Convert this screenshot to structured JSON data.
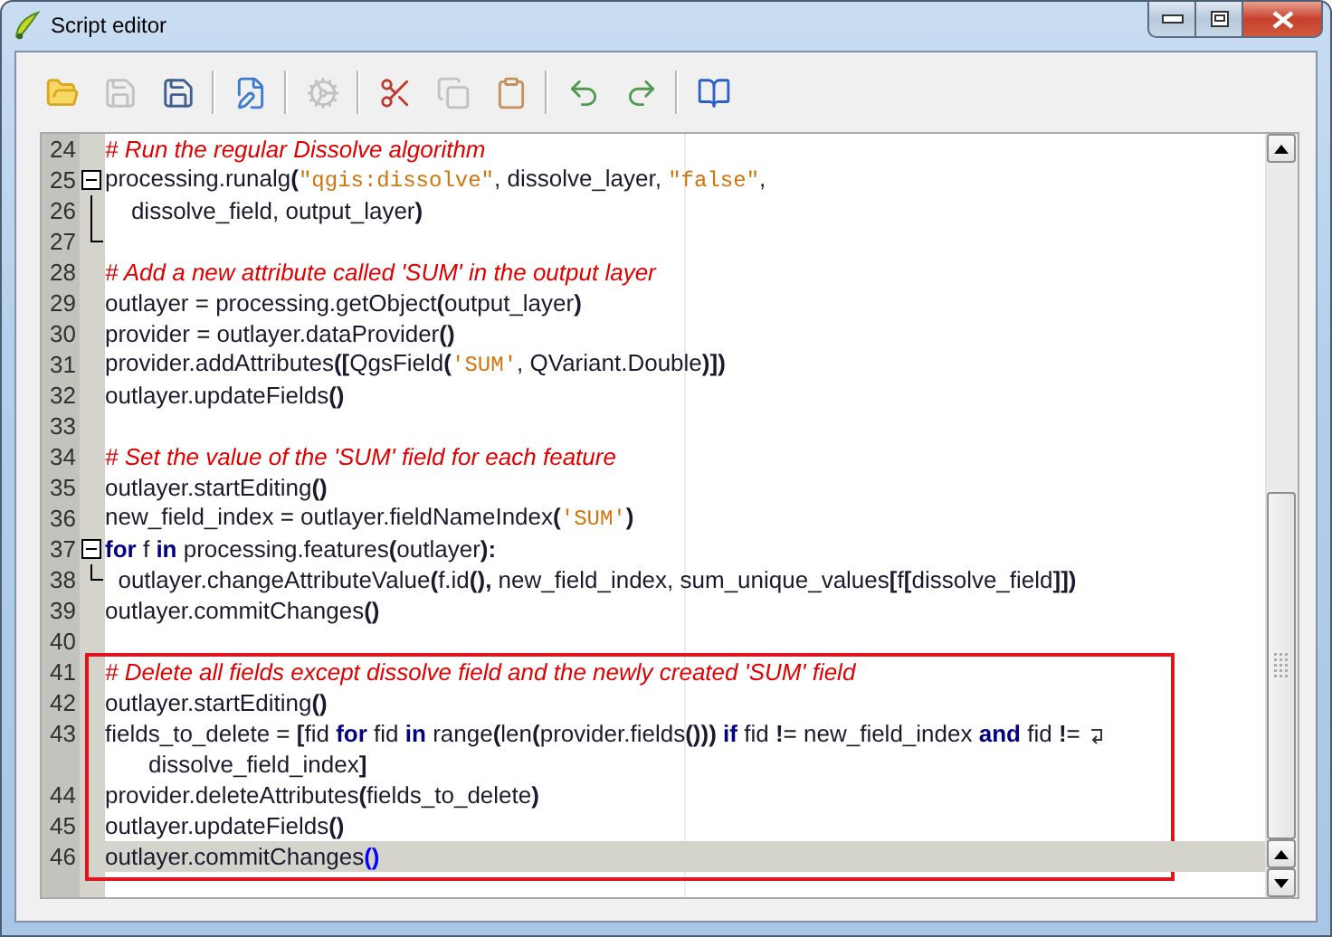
{
  "window": {
    "title": "Script editor",
    "controls": [
      {
        "kind": "minimize"
      },
      {
        "kind": "maximize"
      },
      {
        "kind": "close"
      }
    ]
  },
  "toolbar": [
    {
      "kind": "button",
      "disabled": false
    },
    {
      "kind": "button",
      "disabled": true
    },
    {
      "kind": "button",
      "disabled": false
    },
    {
      "kind": "separator"
    },
    {
      "kind": "button",
      "disabled": false
    },
    {
      "kind": "separator"
    },
    {
      "kind": "button",
      "disabled": true
    },
    {
      "kind": "separator"
    },
    {
      "kind": "button",
      "disabled": false
    },
    {
      "kind": "button",
      "disabled": true
    },
    {
      "kind": "button",
      "disabled": false
    },
    {
      "kind": "separator"
    },
    {
      "kind": "button",
      "disabled": false
    },
    {
      "kind": "button",
      "disabled": false
    },
    {
      "kind": "separator"
    },
    {
      "kind": "button",
      "disabled": false
    }
  ],
  "editor": {
    "blocks": [
      {
        "framed": false,
        "lines": [
          {
            "number": "24",
            "kind": "plain",
            "current": false,
            "tokens": [
              {
                "kind": "comment",
                "text": "# Run the regular Dissolve algorithm"
              }
            ]
          },
          {
            "number": "25",
            "kind": "fold_start",
            "current": false,
            "tokens": [
              {
                "kind": "text",
                "text": "processing.runalg"
              },
              {
                "kind": "op",
                "text": "("
              },
              {
                "kind": "string",
                "text": "\"qgis:dissolve\""
              },
              {
                "kind": "text",
                "text": ", dissolve_layer, "
              },
              {
                "kind": "string",
                "text": "\"false\""
              },
              {
                "kind": "text",
                "text": ","
              }
            ]
          },
          {
            "number": "26",
            "kind": "fold_inside",
            "current": false,
            "tokens": [
              {
                "kind": "text",
                "text": "    dissolve_field, output_layer"
              },
              {
                "kind": "op",
                "text": ")"
              }
            ]
          },
          {
            "number": "27",
            "kind": "fold_end",
            "current": false
          },
          {
            "number": "28",
            "kind": "plain",
            "current": false,
            "tokens": [
              {
                "kind": "comment",
                "text": "# Add a new attribute called 'SUM' in the output layer"
              }
            ]
          },
          {
            "number": "29",
            "kind": "plain",
            "current": false,
            "tokens": [
              {
                "kind": "text",
                "text": "outlayer = processing.getObject"
              },
              {
                "kind": "op",
                "text": "("
              },
              {
                "kind": "text",
                "text": "output_layer"
              },
              {
                "kind": "op",
                "text": ")"
              }
            ]
          },
          {
            "number": "30",
            "kind": "plain",
            "current": false,
            "tokens": [
              {
                "kind": "text",
                "text": "provider = outlayer.dataProvider"
              },
              {
                "kind": "op",
                "text": "()"
              }
            ]
          },
          {
            "number": "31",
            "kind": "plain",
            "current": false,
            "tokens": [
              {
                "kind": "text",
                "text": "provider.addAttributes"
              },
              {
                "kind": "op",
                "text": "(["
              },
              {
                "kind": "text",
                "text": "QgsField"
              },
              {
                "kind": "op",
                "text": "("
              },
              {
                "kind": "string",
                "text": "'SUM'"
              },
              {
                "kind": "text",
                "text": ", QVariant.Double"
              },
              {
                "kind": "op",
                "text": ")])"
              }
            ]
          },
          {
            "number": "32",
            "kind": "plain",
            "current": false,
            "tokens": [
              {
                "kind": "text",
                "text": "outlayer.updateFields"
              },
              {
                "kind": "op",
                "text": "()"
              }
            ]
          },
          {
            "number": "33",
            "kind": "plain",
            "current": false
          },
          {
            "number": "34",
            "kind": "plain",
            "current": false,
            "tokens": [
              {
                "kind": "comment",
                "text": "# Set the value of the 'SUM' field for each feature"
              }
            ]
          },
          {
            "number": "35",
            "kind": "plain",
            "current": false,
            "tokens": [
              {
                "kind": "text",
                "text": "outlayer.startEditing"
              },
              {
                "kind": "op",
                "text": "()"
              }
            ]
          },
          {
            "number": "36",
            "kind": "plain",
            "current": false,
            "tokens": [
              {
                "kind": "text",
                "text": "new_field_index = outlayer.fieldNameIndex"
              },
              {
                "kind": "op",
                "text": "("
              },
              {
                "kind": "string",
                "text": "'SUM'"
              },
              {
                "kind": "op",
                "text": ")"
              }
            ]
          },
          {
            "number": "37",
            "kind": "fold_start",
            "current": false,
            "tokens": [
              {
                "kind": "keyword",
                "text": "for"
              },
              {
                "kind": "text",
                "text": " f "
              },
              {
                "kind": "keyword",
                "text": "in"
              },
              {
                "kind": "text",
                "text": " processing.features"
              },
              {
                "kind": "op",
                "text": "("
              },
              {
                "kind": "text",
                "text": "outlayer"
              },
              {
                "kind": "op",
                "text": "):"
              }
            ]
          },
          {
            "number": "38",
            "kind": "fold_end",
            "current": false,
            "tokens": [
              {
                "kind": "text",
                "text": "  outlayer.changeAttributeValue"
              },
              {
                "kind": "op",
                "text": "("
              },
              {
                "kind": "text",
                "text": "f.id"
              },
              {
                "kind": "op",
                "text": "(),"
              },
              {
                "kind": "text",
                "text": " new_field_index, sum_unique_values"
              },
              {
                "kind": "op",
                "text": "["
              },
              {
                "kind": "text",
                "text": "f"
              },
              {
                "kind": "op",
                "text": "["
              },
              {
                "kind": "text",
                "text": "dissolve_field"
              },
              {
                "kind": "op",
                "text": "]])"
              }
            ]
          },
          {
            "number": "39",
            "kind": "plain",
            "current": false,
            "tokens": [
              {
                "kind": "text",
                "text": "outlayer.commitChanges"
              },
              {
                "kind": "op",
                "text": "()"
              }
            ]
          },
          {
            "number": "40",
            "kind": "plain",
            "current": false
          }
        ]
      },
      {
        "framed": true,
        "lines": [
          {
            "number": "41",
            "kind": "plain",
            "current": false,
            "tokens": [
              {
                "kind": "comment",
                "text": "# Delete all fields except dissolve field and the newly created 'SUM' field"
              }
            ]
          },
          {
            "number": "42",
            "kind": "plain",
            "current": false,
            "tokens": [
              {
                "kind": "text",
                "text": "outlayer.startEditing"
              },
              {
                "kind": "op",
                "text": "()"
              }
            ]
          },
          {
            "number": "43",
            "kind": "plain",
            "current": false,
            "tokens": [
              {
                "kind": "text",
                "text": "fields_to_delete = "
              },
              {
                "kind": "op",
                "text": "["
              },
              {
                "kind": "text",
                "text": "fid "
              },
              {
                "kind": "keyword",
                "text": "for"
              },
              {
                "kind": "text",
                "text": " fid "
              },
              {
                "kind": "keyword",
                "text": "in"
              },
              {
                "kind": "text",
                "text": " range"
              },
              {
                "kind": "op",
                "text": "("
              },
              {
                "kind": "text",
                "text": "len"
              },
              {
                "kind": "op",
                "text": "("
              },
              {
                "kind": "text",
                "text": "provider.fields"
              },
              {
                "kind": "op",
                "text": "()))"
              },
              {
                "kind": "keyword",
                "text": " if"
              },
              {
                "kind": "text",
                "text": " fid "
              },
              {
                "kind": "op",
                "text": "!"
              },
              {
                "kind": "text",
                "text": "= new_field_index "
              },
              {
                "kind": "keyword",
                "text": "and"
              },
              {
                "kind": "text",
                "text": " fid "
              },
              {
                "kind": "op",
                "text": "!"
              },
              {
                "kind": "text",
                "text": "= "
              }
            ],
            "continuation": [
              {
                "kind": "text",
                "text": "dissolve_field_index"
              },
              {
                "kind": "op",
                "text": "]"
              }
            ]
          },
          {
            "number": "44",
            "kind": "plain",
            "current": false,
            "tokens": [
              {
                "kind": "text",
                "text": "provider.deleteAttributes"
              },
              {
                "kind": "op",
                "text": "("
              },
              {
                "kind": "text",
                "text": "fields_to_delete"
              },
              {
                "kind": "op",
                "text": ")"
              }
            ]
          },
          {
            "number": "45",
            "kind": "plain",
            "current": false,
            "tokens": [
              {
                "kind": "text",
                "text": "outlayer.updateFields"
              },
              {
                "kind": "op",
                "text": "()"
              }
            ]
          },
          {
            "number": "46",
            "kind": "plain",
            "current": true,
            "tokens": [
              {
                "kind": "text",
                "text": "outlayer.commitChanges"
              },
              {
                "kind": "match",
                "text": "()"
              }
            ]
          }
        ]
      }
    ]
  }
}
